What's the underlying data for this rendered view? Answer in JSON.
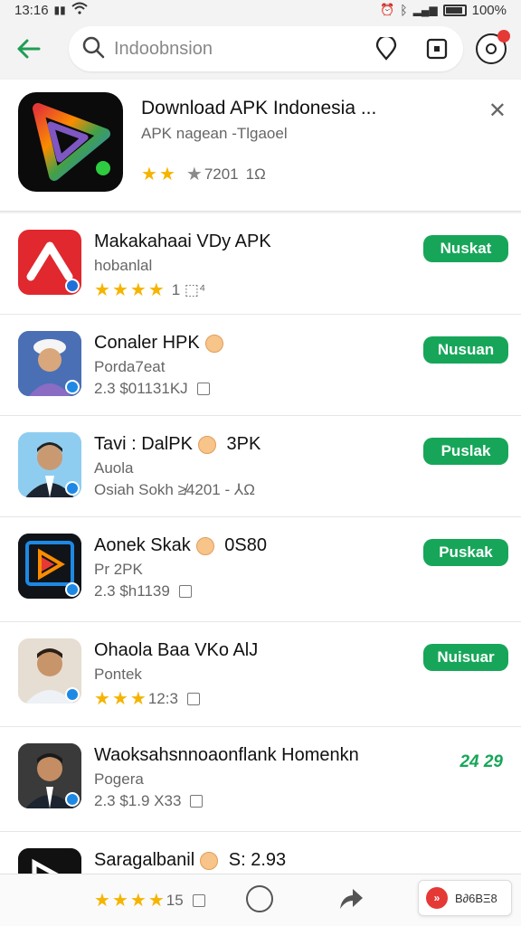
{
  "status_bar": {
    "time": "13:16",
    "battery": "100%"
  },
  "search": {
    "back_label": "←",
    "query": "Indoobnsion"
  },
  "featured": {
    "title": "Download APK Indonesia ...",
    "subtitle": "APK nagean -Tlgaoel",
    "rating_text": "7201",
    "rating_extra": "1Ω"
  },
  "items": [
    {
      "title": "Makakahaai VDy APK",
      "sub": "hobanlal",
      "meta": "1 ⬚⁴",
      "button": "Nuskat",
      "stars": 4
    },
    {
      "title": "Conaler HPK",
      "sub": "Porda7eat",
      "meta": "2.3 $01131KJ",
      "button": "Nusuan",
      "stars": 0
    },
    {
      "title": "Tavi : DalPK",
      "extra": "3PK",
      "sub": "Auola",
      "meta": "Osiah Sokh ≱4201 - ⅄Ω",
      "button": "Puslak",
      "stars": 0
    },
    {
      "title": "Aonek Skak",
      "extra": "0S80",
      "sub": "Pr 2PK",
      "meta": "2.3 $h1139",
      "button": "Puskak",
      "stars": 0
    },
    {
      "title": "Ohaola Baa VKo AlJ",
      "sub": "Pontek",
      "meta": "12:3",
      "button": "Nuisuar",
      "stars": 3
    },
    {
      "title": "Waoksahsnnoaonflank Homenkn",
      "sub": "Pogera",
      "meta": "2.3 $1.9 X33",
      "green": "24 29",
      "stars": 0
    },
    {
      "title": "Saragalbanil",
      "extra": "S: 2.93",
      "sub": "",
      "meta": "15",
      "stars": 4
    }
  ],
  "bottom_nav": {
    "pill_label": "B∂6BΞ8",
    "pill_icon": "»"
  },
  "colors": {
    "accent_green": "#17a659",
    "star_yellow": "#f5b400",
    "red": "#e53935"
  }
}
